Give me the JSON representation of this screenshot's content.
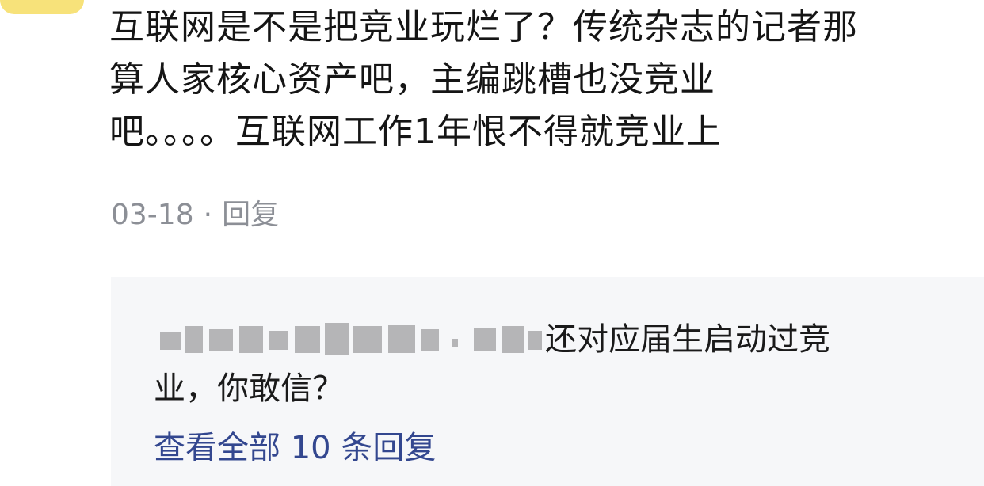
{
  "comment": {
    "lines": [
      "互联网是不是把竞业玩烂了？传统杂志的记者那",
      "算人家核心资产吧，主编跳槽也没竞业",
      "吧。。。。互联网工作1年恨不得就竞业上"
    ],
    "date": "03-18",
    "separator": "·",
    "reply_label": "回复"
  },
  "reply_thread": {
    "reply_text_line1": "还对应届生启动过竞",
    "reply_text_line2": "业，你敢信？",
    "view_all_label": "查看全部 10 条回复"
  },
  "colors": {
    "text_primary": "#151515",
    "text_meta": "#8c8f96",
    "link": "#33478f",
    "reply_background": "#f6f7f9",
    "mosaic": "#a9a9ac"
  }
}
